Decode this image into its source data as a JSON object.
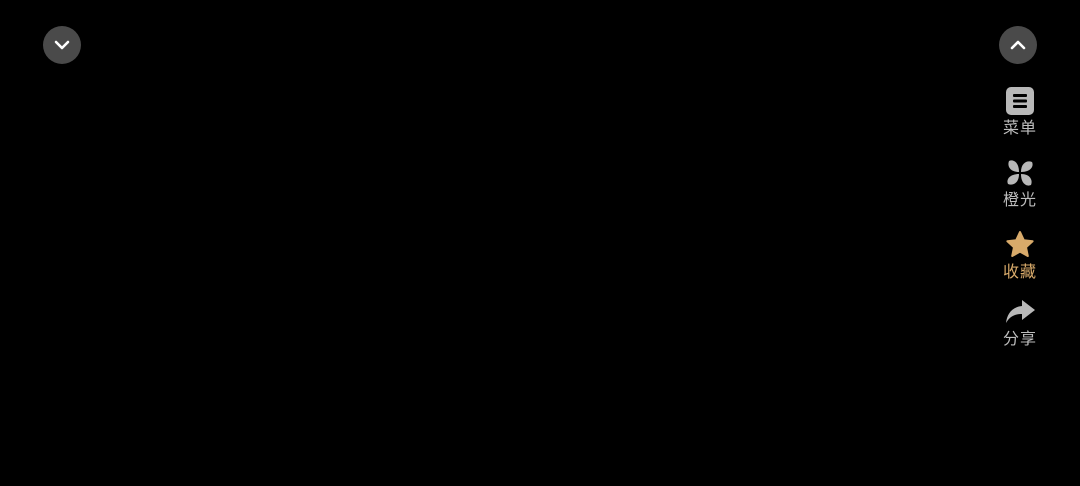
{
  "controls": {
    "collapse_icon": "chevron-down-icon",
    "expand_icon": "chevron-up-icon"
  },
  "sidebar": {
    "items": [
      {
        "label": "菜单",
        "icon": "menu-icon"
      },
      {
        "label": "橙光",
        "icon": "pinwheel-icon"
      },
      {
        "label": "收藏",
        "icon": "star-icon",
        "color": "#d8aa6a"
      },
      {
        "label": "分享",
        "icon": "share-icon"
      }
    ]
  },
  "colors": {
    "background": "#000000",
    "button_bg": "#4a4a4a",
    "icon": "#b8b8b8",
    "label": "#bdbdbd",
    "accent": "#d8aa6a"
  }
}
